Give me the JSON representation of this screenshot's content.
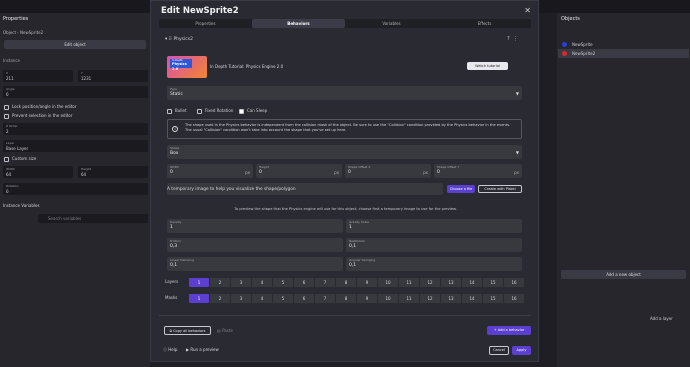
{
  "left_panel": {
    "title": "Properties",
    "subtitle": "Object - NewSprite2",
    "edit_button": "Edit object",
    "instance_label": "Instance",
    "x_label": "X",
    "x_value": "211",
    "y_label": "Y",
    "y_value": "1231",
    "angle_label": "Angle",
    "angle_value": "0",
    "lock_label": "Lock position/angle in the editor",
    "prevent_label": "Prevent selection in the editor",
    "zorder_label": "Z Order",
    "zorder_value": "2",
    "layer_label": "Layer",
    "layer_value": "Base Layer",
    "custom_size_label": "Custom size",
    "width_label": "Width",
    "width_value": "64",
    "height_label": "Height",
    "height_value": "64",
    "rotation_label": "Rotation",
    "rotation_value": "0",
    "instance_vars_label": "Instance Variables",
    "search_placeholder": "Search variables"
  },
  "right_panel": {
    "title": "Objects",
    "items": [
      {
        "label": "NewSprite",
        "color": "#2a3fd8"
      },
      {
        "label": "NewSprite2",
        "color": "#d82a2a"
      }
    ],
    "add_object": "Add a new object",
    "add_layer": "Add a layer"
  },
  "modal": {
    "title": "Edit NewSprite2",
    "close_icon": "close-icon",
    "tabs": [
      "Properties",
      "Behaviors",
      "Variables",
      "Effects"
    ],
    "active_tab": "Behaviors",
    "behavior_name": "Physics2",
    "tutorial_thumb_small": "In Depth",
    "tutorial_thumb_title": "Physics 2.0",
    "tutorial_text": "In Depth Tutorial: Physics Engine 2.0",
    "watch_tutorial": "Watch tutorial",
    "type_label": "Type",
    "type_value": "Static",
    "bullet_label": "Bullet",
    "fixed_rotation_label": "Fixed Rotation",
    "can_sleep_label": "Can Sleep",
    "info_text": "The shape used in the Physics behavior is independent from the collision mask of the object. Be sure to use the \"Collision\" condition provided by the Physics behavior in the events. The usual \"Collision\" condition won't take into account the shape that you've set up here.",
    "shape_label": "Shape",
    "shape_value": "Box",
    "width_label": "Width",
    "width_value": "0",
    "width_unit": "px",
    "height_label": "Height",
    "height_value": "0",
    "height_unit": "px",
    "offset_x_label": "Shape Offset X",
    "offset_x_value": "0",
    "offset_x_unit": "px",
    "offset_y_label": "Shape Offset Y",
    "offset_y_value": "0",
    "offset_y_unit": "px",
    "temp_image_text": "A temporary image to help you visualize the shape/polygon",
    "choose_file": "Choose a file",
    "create_piskel": "Create with Piskel",
    "preview_desc": "To preview the shape that the Physics engine will use for this object, choose first a temporary image to use for the preview.",
    "density_label": "Density",
    "density_value": "1",
    "gravity_label": "Gravity Scale",
    "gravity_value": "1",
    "friction_label": "Friction",
    "friction_value": "0,3",
    "restitution_label": "Restitution",
    "restitution_value": "0,1",
    "linear_damping_label": "Linear Damping",
    "linear_damping_value": "0,1",
    "angular_damping_label": "Angular Damping",
    "angular_damping_value": "0,1",
    "layers_label": "Layers",
    "masks_label": "Masks",
    "layer_numbers": [
      "1",
      "2",
      "3",
      "4",
      "5",
      "6",
      "7",
      "8",
      "9",
      "10",
      "11",
      "12",
      "13",
      "14",
      "15",
      "16"
    ],
    "copy_all": "Copy all behaviors",
    "paste": "Paste",
    "add_behavior": "Add a behavior",
    "help": "Help",
    "preview": "Run a preview",
    "cancel": "Cancel",
    "apply": "Apply"
  },
  "colors": {
    "accent": "#5b3fd1"
  }
}
